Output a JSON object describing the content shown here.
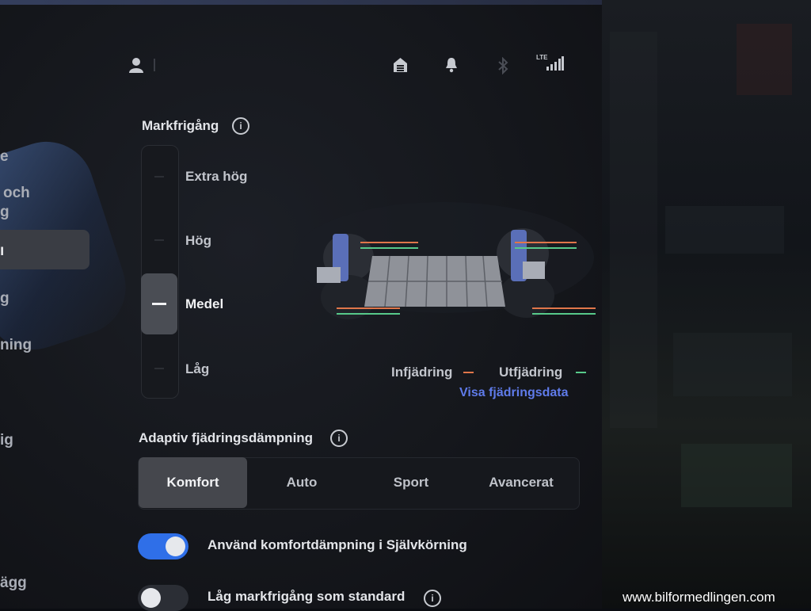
{
  "sidebar": {
    "items": [
      {
        "label": "e"
      },
      {
        "label": "och"
      },
      {
        "label": "g"
      },
      {
        "label": "ı"
      },
      {
        "label": "g"
      },
      {
        "label": "ning"
      },
      {
        "label": "ig"
      },
      {
        "label": "ägg"
      }
    ]
  },
  "status_bar": {
    "network": "LTE"
  },
  "ride_height": {
    "title": "Markfrigång",
    "options": [
      "Extra hög",
      "Hög",
      "Medel",
      "Låg"
    ],
    "selected": "Medel",
    "selected_index": 2
  },
  "suspension_legend": {
    "compression": "Infjädring",
    "rebound": "Utfjädring",
    "compression_color": "#e0764a",
    "rebound_color": "#57c98a",
    "link": "Visa fjädringsdata"
  },
  "damping": {
    "title": "Adaptiv fjädringsdämpning",
    "options": [
      "Komfort",
      "Auto",
      "Sport",
      "Avancerat"
    ],
    "selected": "Komfort"
  },
  "toggles": [
    {
      "label": "Använd komfortdämpning i Självkörning",
      "on": true
    },
    {
      "label": "Låg markfrigång som standard",
      "on": false
    }
  ],
  "colors": {
    "accent": "#2f6fe8",
    "link": "#5f7bea"
  },
  "watermark": "www.bilformedlingen.com"
}
